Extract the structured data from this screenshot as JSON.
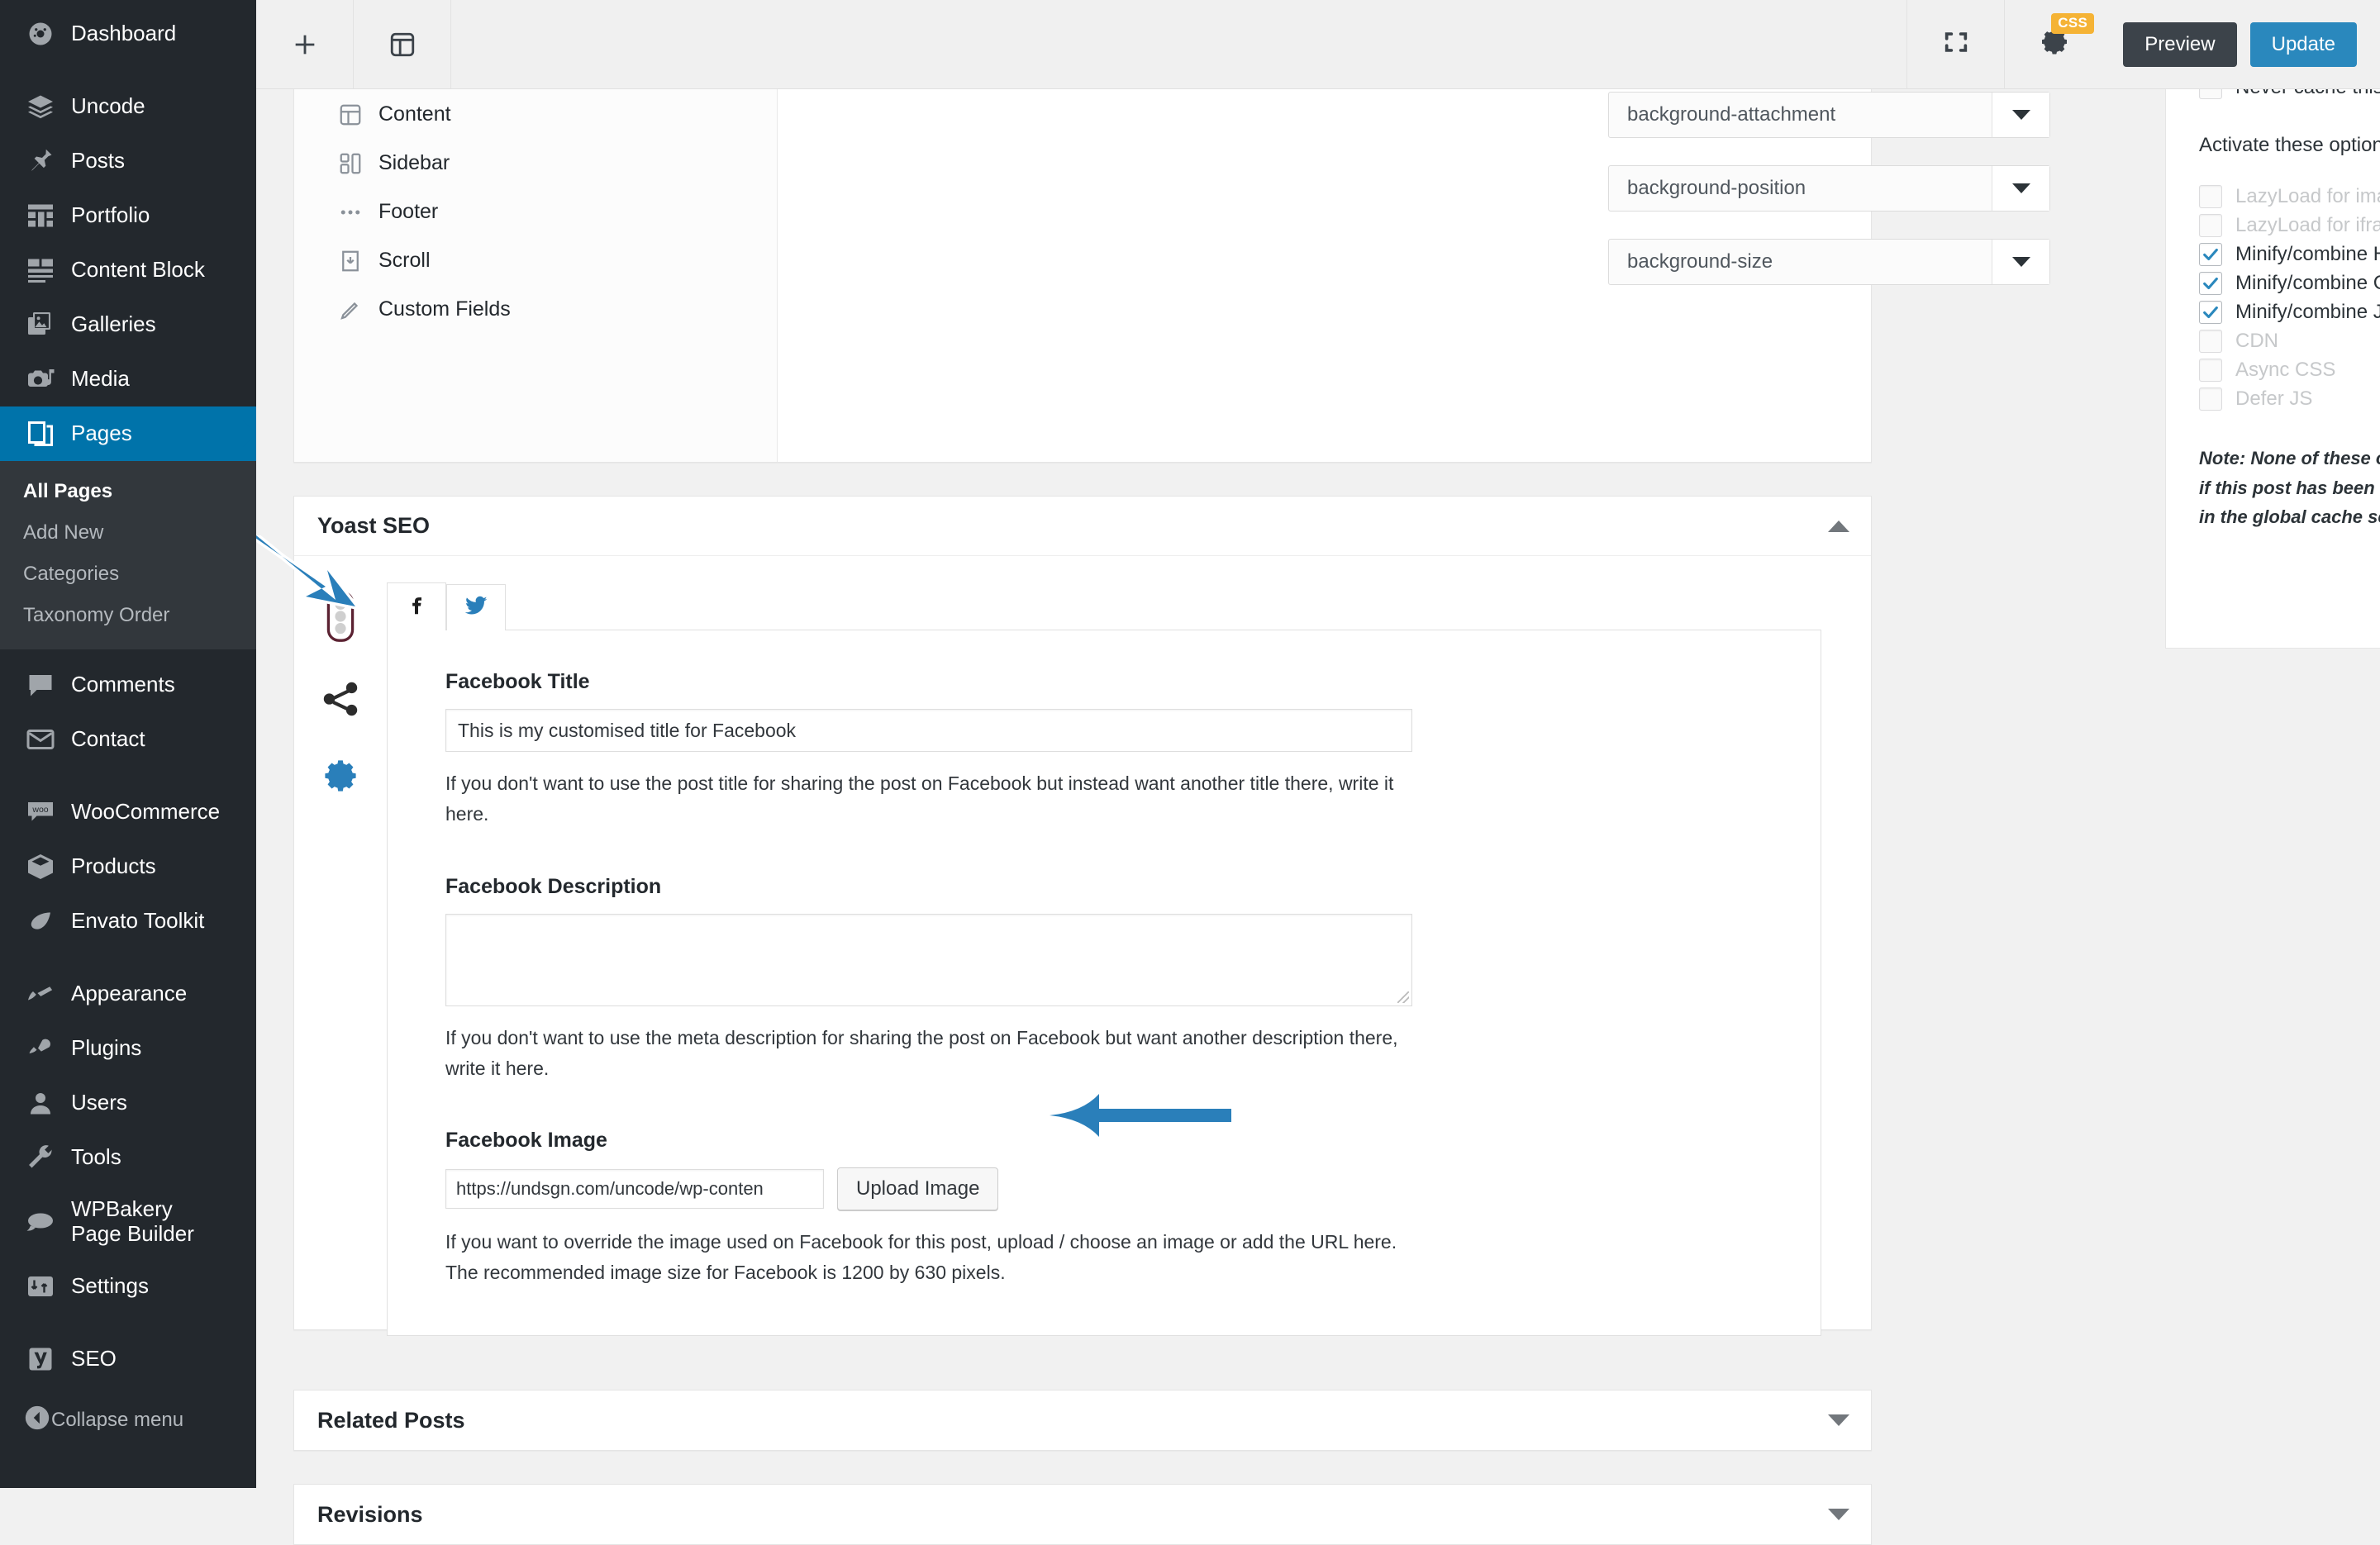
{
  "admin_sidebar": {
    "items": [
      {
        "label": "Dashboard",
        "icon": "dashboard-icon"
      },
      {
        "label": "Uncode",
        "icon": "layers-icon"
      },
      {
        "label": "Posts",
        "icon": "pin-icon"
      },
      {
        "label": "Portfolio",
        "icon": "portfolio-grid-icon"
      },
      {
        "label": "Content Block",
        "icon": "content-block-icon"
      },
      {
        "label": "Galleries",
        "icon": "galleries-icon"
      },
      {
        "label": "Media",
        "icon": "media-icon"
      },
      {
        "label": "Pages",
        "icon": "pages-icon",
        "current": true
      },
      {
        "label": "Comments",
        "icon": "comments-icon"
      },
      {
        "label": "Contact",
        "icon": "envelope-icon"
      },
      {
        "label": "WooCommerce",
        "icon": "woocommerce-icon"
      },
      {
        "label": "Products",
        "icon": "products-box-icon"
      },
      {
        "label": "Envato Toolkit",
        "icon": "envato-leaf-icon"
      },
      {
        "label": "Appearance",
        "icon": "paintbrush-icon"
      },
      {
        "label": "Plugins",
        "icon": "plug-icon"
      },
      {
        "label": "Users",
        "icon": "user-icon"
      },
      {
        "label": "Tools",
        "icon": "wrench-icon"
      },
      {
        "label": "WPBakery Page Builder",
        "icon": "wpbakery-icon"
      },
      {
        "label": "Settings",
        "icon": "settings-sliders-icon"
      },
      {
        "label": "SEO",
        "icon": "yoast-icon"
      }
    ],
    "pages_submenu": [
      {
        "label": "All Pages",
        "current": true
      },
      {
        "label": "Add New",
        "current": false
      },
      {
        "label": "Categories",
        "current": false
      },
      {
        "label": "Taxonomy Order",
        "current": false
      }
    ],
    "collapse_label": "Collapse menu"
  },
  "topbar": {
    "add_block_icon": "plus-icon",
    "layout_icon": "layout-columns-icon",
    "fullscreen_icon": "fullscreen-icon",
    "css_icon": "gear-icon",
    "css_badge": "CSS",
    "preview_label": "Preview",
    "update_label": "Update",
    "update_color": "#2a88bd",
    "preview_color": "#3c434a",
    "badge_color": "#f5b335"
  },
  "uncode_box": {
    "nav_items": [
      {
        "label": "Content",
        "icon": "layout-panel-icon"
      },
      {
        "label": "Sidebar",
        "icon": "sidebar-icon"
      },
      {
        "label": "Footer",
        "icon": "dots-icon"
      },
      {
        "label": "Scroll",
        "icon": "scroll-download-icon"
      },
      {
        "label": "Custom Fields",
        "icon": "pencil-icon"
      }
    ],
    "selects": [
      {
        "label": "background-attachment"
      },
      {
        "label": "background-position"
      },
      {
        "label": "background-size"
      }
    ]
  },
  "yoast": {
    "panel_title": "Yoast SEO",
    "toggle_icon": "triangle-up-icon",
    "sidebar_icons": [
      {
        "name": "content-optimization-icon",
        "label": "SEO traffic light"
      },
      {
        "name": "share-icon",
        "label": "Social"
      },
      {
        "name": "gear-icon",
        "label": "Advanced"
      }
    ],
    "tabs": [
      {
        "icon": "facebook-icon",
        "label": "Facebook",
        "active": true
      },
      {
        "icon": "twitter-icon",
        "label": "Twitter",
        "active": false
      }
    ],
    "facebook_title_label": "Facebook Title",
    "facebook_title_value": "This is my customised title for Facebook",
    "facebook_title_help": "If you don't want to use the post title for sharing the post on Facebook but instead want another title there, write it here.",
    "facebook_description_label": "Facebook Description",
    "facebook_description_value": "",
    "facebook_description_help": "If you don't want to use the meta description for sharing the post on Facebook but want another description there, write it here.",
    "facebook_image_label": "Facebook Image",
    "facebook_image_value": "https://undsgn.com/uncode/wp-conten",
    "upload_button_label": "Upload Image",
    "facebook_image_help": "If you want to override the image used on Facebook for this post, upload / choose an image or add the URL here. The recommended image size for Facebook is 1200 by 630 pixels."
  },
  "collapsed_boxes": [
    {
      "title": "Related Posts",
      "toggle_icon": "triangle-down-icon"
    },
    {
      "title": "Revisions",
      "toggle_icon": "triangle-down-icon"
    }
  ],
  "cache_box": {
    "never_cache_label": "Never cache this page",
    "heading": "Activate these options on this post:",
    "options": [
      {
        "label": "LazyLoad for images",
        "checked": false,
        "disabled": true
      },
      {
        "label": "LazyLoad for iframes/videos",
        "checked": false,
        "disabled": true
      },
      {
        "label": "Minify/combine HTML",
        "checked": true,
        "disabled": false
      },
      {
        "label": "Minify/combine CSS",
        "checked": true,
        "disabled": false
      },
      {
        "label": "Minify/combine JS",
        "checked": true,
        "disabled": false
      },
      {
        "label": "CDN",
        "checked": false,
        "disabled": true
      },
      {
        "label": "Async CSS",
        "checked": false,
        "disabled": true
      },
      {
        "label": "Defer JS",
        "checked": false,
        "disabled": true
      }
    ],
    "note": "Note: None of these options will be applied if this post has been excluded from cache in the global cache settings.",
    "check_color": "#2a88bd"
  },
  "annotations": {
    "arrow_color": "#2a7fba",
    "arrow1_target": "yoast-social-share-icon",
    "arrow2_target": "upload-image-button"
  }
}
